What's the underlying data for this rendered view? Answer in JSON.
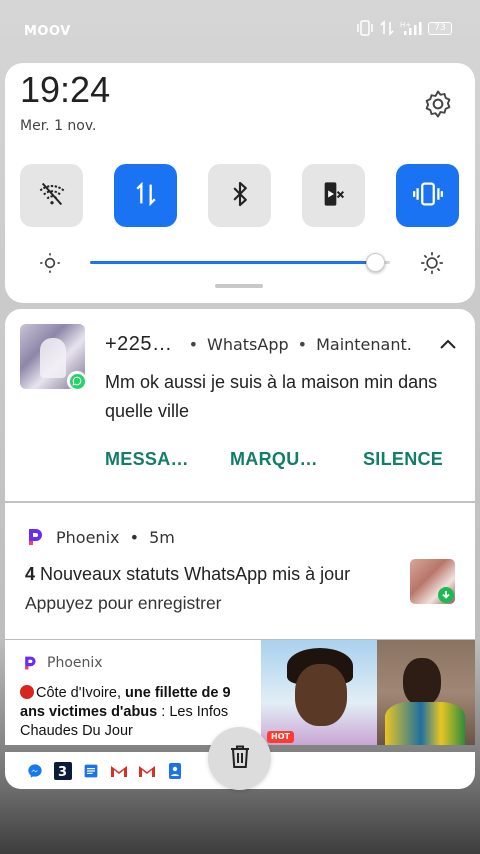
{
  "status_bar": {
    "carrier": "MOOV",
    "battery_level": "73",
    "icons": [
      "vibrate-icon",
      "data-transfer-icon",
      "signal-h-plus-icon",
      "battery-icon"
    ]
  },
  "quick_settings": {
    "time": "19:24",
    "date": "Mer. 1 nov.",
    "tiles": [
      {
        "name": "wifi-off-icon",
        "active": false
      },
      {
        "name": "mobile-data-icon",
        "active": true
      },
      {
        "name": "bluetooth-icon",
        "active": false
      },
      {
        "name": "media-mute-icon",
        "active": false
      },
      {
        "name": "vibrate-mode-icon",
        "active": true
      }
    ],
    "brightness_level": 0.95,
    "accent_color": "#1a73f2"
  },
  "whatsapp_notification": {
    "sender": "+225…",
    "app_name": "WhatsApp",
    "time": "Maintenant.",
    "message": "Mm ok aussi je suis à la maison min dans quelle ville",
    "actions": {
      "reply": "MESSA…",
      "mark_read": "MARQU…",
      "mute": "SILENCE"
    },
    "action_color": "#127d68"
  },
  "phoenix_notification": {
    "app_name": "Phoenix",
    "time": "5m",
    "title_count": "4",
    "title_rest": " Nouveaux statuts WhatsApp mis à jour",
    "subtitle": "Appuyez pour enregistrer"
  },
  "news_notification": {
    "app_name": "Phoenix",
    "text_prefix": "Côte d'Ivoire, ",
    "text_bold": "une fillette de 9 ans victimes d'abus",
    "text_suffix": " : Les Infos Chaudes Du Jour",
    "image_tag": "HOT"
  },
  "dock": {
    "icons": [
      "messenger-icon",
      "app-store-icon",
      "google-docs-icon",
      "gmail-icon",
      "gmail-icon-2",
      "contacts-icon"
    ]
  },
  "clear_all": {
    "icon": "trash-icon"
  }
}
